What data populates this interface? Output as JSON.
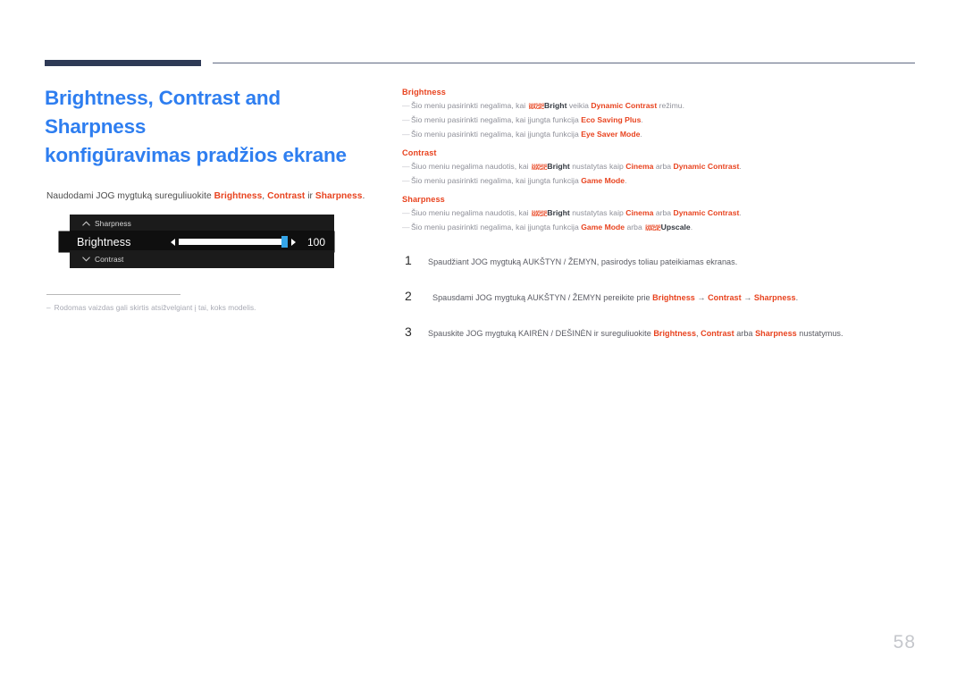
{
  "colors": {
    "title_blue": "#2e7ef0",
    "accent_red": "#e8431f",
    "rule_navy": "#2e3a56",
    "body_gray": "#5a5b63",
    "note_gray": "#8f9099",
    "page_num_gray": "#c5c7cc"
  },
  "header": {
    "rule_thick": "",
    "rule_thin": ""
  },
  "title": {
    "line1": "Brightness, Contrast and Sharpness",
    "line2": "konfigūravimas pradžios ekrane"
  },
  "intro": {
    "prefix": "Naudodami JOG mygtuką sureguliuokite ",
    "term1": "Brightness",
    "sep1": ", ",
    "term2": "Contrast",
    "sep2": " ir ",
    "term3": "Sharpness",
    "suffix": "."
  },
  "osd": {
    "top_row": {
      "chevron": "chevron-up",
      "label": "Sharpness"
    },
    "active_row": {
      "label": "Brightness",
      "value": "100",
      "left_arrow": "◄",
      "right_arrow": "►",
      "fill_percent": 100
    },
    "bottom_row": {
      "chevron": "chevron-down",
      "label": "Contrast"
    }
  },
  "footnote": {
    "dash": "–",
    "text": "Rodomas vaizdas gali skirtis atsižvelgiant į tai, koks modelis."
  },
  "notes": [
    {
      "heading": "Brightness",
      "lines": [
        {
          "dash": "—",
          "segments": [
            {
              "t": "Šio meniu pasirinkti negalima, kai ",
              "s": "plain"
            },
            {
              "t": "SAMSUNG MAGIC",
              "s": "logo"
            },
            {
              "t": "Bright",
              "s": "strong"
            },
            {
              "t": " veikia ",
              "s": "plain"
            },
            {
              "t": "Dynamic Contrast",
              "s": "red"
            },
            {
              "t": " režimu.",
              "s": "plain"
            }
          ]
        },
        {
          "dash": "—",
          "segments": [
            {
              "t": "Šio meniu pasirinkti negalima, kai įjungta funkcija ",
              "s": "plain"
            },
            {
              "t": "Eco Saving Plus",
              "s": "red"
            },
            {
              "t": ".",
              "s": "plain"
            }
          ]
        },
        {
          "dash": "—",
          "segments": [
            {
              "t": "Šio meniu pasirinkti negalima, kai įjungta funkcija ",
              "s": "plain"
            },
            {
              "t": "Eye Saver Mode",
              "s": "red"
            },
            {
              "t": ".",
              "s": "plain"
            }
          ]
        }
      ]
    },
    {
      "heading": "Contrast",
      "lines": [
        {
          "dash": "—",
          "segments": [
            {
              "t": "Šiuo meniu negalima naudotis, kai ",
              "s": "plain"
            },
            {
              "t": "SAMSUNG MAGIC",
              "s": "logo"
            },
            {
              "t": "Bright",
              "s": "strong"
            },
            {
              "t": " nustatytas kaip ",
              "s": "plain"
            },
            {
              "t": "Cinema",
              "s": "red"
            },
            {
              "t": " arba ",
              "s": "plain"
            },
            {
              "t": "Dynamic Contrast",
              "s": "red"
            },
            {
              "t": ".",
              "s": "plain"
            }
          ]
        },
        {
          "dash": "—",
          "segments": [
            {
              "t": "Šio meniu pasirinkti negalima, kai įjungta funkcija ",
              "s": "plain"
            },
            {
              "t": "Game Mode",
              "s": "red"
            },
            {
              "t": ".",
              "s": "plain"
            }
          ]
        }
      ]
    },
    {
      "heading": "Sharpness",
      "lines": [
        {
          "dash": "—",
          "segments": [
            {
              "t": "Šiuo meniu negalima naudotis, kai ",
              "s": "plain"
            },
            {
              "t": "SAMSUNG MAGIC",
              "s": "logo"
            },
            {
              "t": "Bright",
              "s": "strong"
            },
            {
              "t": " nustatytas kaip ",
              "s": "plain"
            },
            {
              "t": "Cinema",
              "s": "red"
            },
            {
              "t": " arba ",
              "s": "plain"
            },
            {
              "t": "Dynamic Contrast",
              "s": "red"
            },
            {
              "t": ".",
              "s": "plain"
            }
          ]
        },
        {
          "dash": "—",
          "segments": [
            {
              "t": "Šio meniu pasirinkti negalima, kai įjungta funkcija ",
              "s": "plain"
            },
            {
              "t": "Game Mode",
              "s": "red"
            },
            {
              "t": " arba ",
              "s": "plain"
            },
            {
              "t": "SAMSUNG MAGIC",
              "s": "logo"
            },
            {
              "t": "Upscale",
              "s": "strong"
            },
            {
              "t": ".",
              "s": "plain"
            }
          ]
        }
      ]
    }
  ],
  "steps": [
    {
      "num": "1",
      "indent": false,
      "segments": [
        {
          "t": "Spaudžiant JOG mygtuką AUKŠTYN / ŽEMYN, pasirodys toliau pateikiamas ekranas.",
          "s": "plain"
        }
      ]
    },
    {
      "num": "2",
      "indent": true,
      "segments": [
        {
          "t": "Spausdami JOG mygtuką AUKŠTYN / ŽEMYN pereikite prie ",
          "s": "plain"
        },
        {
          "t": "Brightness",
          "s": "red"
        },
        {
          "t": " → ",
          "s": "plain"
        },
        {
          "t": "Contrast",
          "s": "red"
        },
        {
          "t": " → ",
          "s": "plain"
        },
        {
          "t": "Sharpness",
          "s": "red"
        },
        {
          "t": ".",
          "s": "plain"
        }
      ]
    },
    {
      "num": "3",
      "indent": false,
      "segments": [
        {
          "t": "Spauskite JOG mygtuką KAIRĖN / DEŠINĖN ir sureguliuokite ",
          "s": "plain"
        },
        {
          "t": "Brightness",
          "s": "red"
        },
        {
          "t": ", ",
          "s": "plain"
        },
        {
          "t": "Contrast",
          "s": "red"
        },
        {
          "t": " arba ",
          "s": "plain"
        },
        {
          "t": "Sharpness",
          "s": "red"
        },
        {
          "t": " nustatymus.",
          "s": "plain"
        }
      ]
    }
  ],
  "page_number": "58"
}
